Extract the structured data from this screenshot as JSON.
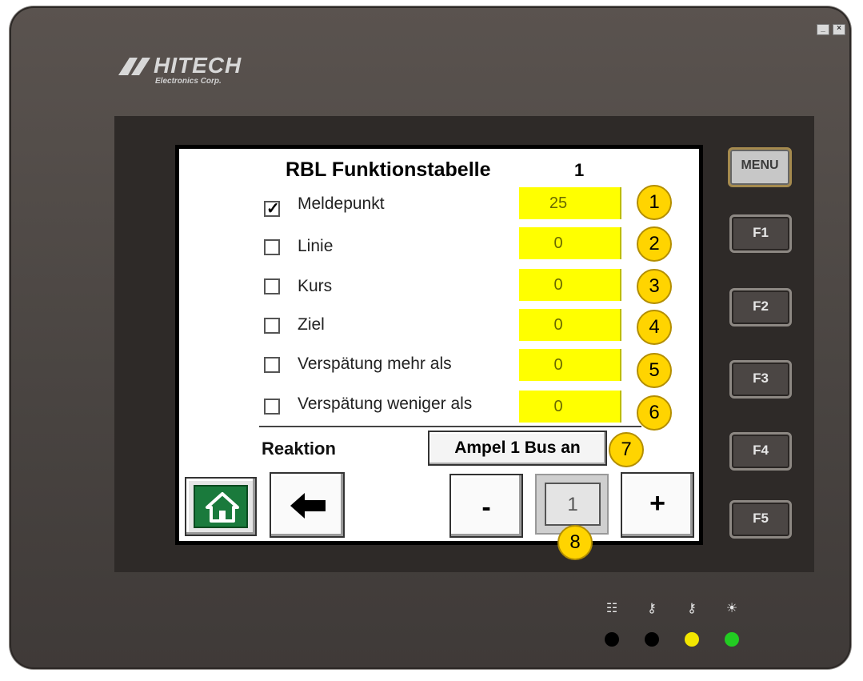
{
  "window": {
    "minimize_glyph": "_",
    "close_glyph": "×"
  },
  "logo": {
    "brand": "HITECH",
    "sub": "Electronics Corp."
  },
  "screen": {
    "title": "RBL Funktionstabelle",
    "table_number": "1",
    "rows": [
      {
        "label": "Meldepunkt",
        "checked": true,
        "value": "25"
      },
      {
        "label": "Linie",
        "checked": false,
        "value": "0"
      },
      {
        "label": "Kurs",
        "checked": false,
        "value": "0"
      },
      {
        "label": "Ziel",
        "checked": false,
        "value": "0"
      },
      {
        "label": "Verspätung mehr als",
        "checked": false,
        "value": "0"
      },
      {
        "label": "Verspätung weniger als",
        "checked": false,
        "value": "0"
      }
    ],
    "reaction_label": "Reaktion",
    "reaction_value": "Ampel 1 Bus an",
    "nav": {
      "minus": "-",
      "page": "1",
      "plus": "+"
    }
  },
  "side_keys": [
    "MENU",
    "F1",
    "F2",
    "F3",
    "F4",
    "F5"
  ],
  "callouts": [
    "1",
    "2",
    "3",
    "4",
    "5",
    "6",
    "7",
    "8"
  ],
  "leds": [
    {
      "icon": "network-icon",
      "glyph": "☷",
      "color": "#000000"
    },
    {
      "icon": "key-icon",
      "glyph": "⚷",
      "color": "#000000"
    },
    {
      "icon": "key-icon",
      "glyph": "⚷",
      "color": "#f2e600"
    },
    {
      "icon": "light-icon",
      "glyph": "☀",
      "color": "#22cc22"
    }
  ],
  "colors": {
    "value_bg": "#ffff00",
    "callout": "#ffd400",
    "home": "#1a7a3c"
  }
}
